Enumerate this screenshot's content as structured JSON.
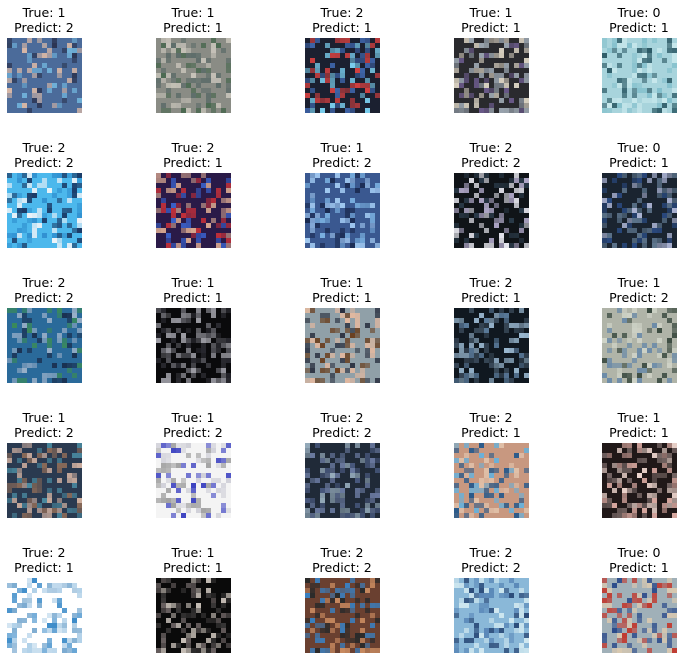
{
  "chart_data": {
    "type": "image_grid",
    "title": "",
    "rows": 5,
    "cols": 5,
    "images": [
      {
        "true_label": 1,
        "predicted_label": 2,
        "colors": [
          "#4b6b9a",
          "#2a3350",
          "#d9b8a6",
          "#6fb0d8"
        ]
      },
      {
        "true_label": 1,
        "predicted_label": 1,
        "colors": [
          "#8a8c85",
          "#4a6850",
          "#c7c3b9",
          "#5e6d6a"
        ]
      },
      {
        "true_label": 2,
        "predicted_label": 1,
        "colors": [
          "#1b2030",
          "#3e64a8",
          "#7bd0f0",
          "#d04040"
        ]
      },
      {
        "true_label": 1,
        "predicted_label": 1,
        "colors": [
          "#2a2a2e",
          "#d8d0c0",
          "#9aa4ae",
          "#6a5a8a"
        ]
      },
      {
        "true_label": 0,
        "predicted_label": 1,
        "colors": [
          "#a8d4dc",
          "#84c0cc",
          "#2c5a66",
          "#c8e8ec"
        ]
      },
      {
        "true_label": 2,
        "predicted_label": 2,
        "colors": [
          "#4cb8ec",
          "#1a3a66",
          "#f0f4f8",
          "#3090d0"
        ]
      },
      {
        "true_label": 2,
        "predicted_label": 1,
        "colors": [
          "#2a1a48",
          "#c0303a",
          "#3a60c8",
          "#d8a890"
        ]
      },
      {
        "true_label": 1,
        "predicted_label": 2,
        "colors": [
          "#3a5890",
          "#7ab0e0",
          "#1a2a50",
          "#a0c8f0"
        ]
      },
      {
        "true_label": 2,
        "predicted_label": 2,
        "colors": [
          "#101418",
          "#2a3a48",
          "#b0a8c8",
          "#e8e8f0"
        ]
      },
      {
        "true_label": 0,
        "predicted_label": 1,
        "colors": [
          "#1a2430",
          "#2a4a80",
          "#b0b8d8",
          "#607890"
        ]
      },
      {
        "true_label": 2,
        "predicted_label": 2,
        "colors": [
          "#2a6a9a",
          "#3a8a5a",
          "#9ab0c8",
          "#1a3050"
        ]
      },
      {
        "true_label": 1,
        "predicted_label": 1,
        "colors": [
          "#0a0a0c",
          "#2a2a30",
          "#a0a0a8",
          "#5a5a60"
        ]
      },
      {
        "true_label": 1,
        "predicted_label": 1,
        "colors": [
          "#90a0a8",
          "#6a4020",
          "#e0b8a0",
          "#2a3040"
        ]
      },
      {
        "true_label": 2,
        "predicted_label": 1,
        "colors": [
          "#101820",
          "#3a4a5a",
          "#9ab8d0",
          "#5a7a9a"
        ]
      },
      {
        "true_label": 1,
        "predicted_label": 2,
        "colors": [
          "#b0b4a8",
          "#3a4a40",
          "#6a8aa8",
          "#d0d4c8"
        ]
      },
      {
        "true_label": 1,
        "predicted_label": 2,
        "colors": [
          "#2a3a50",
          "#8a6a58",
          "#d0b0a0",
          "#4a8aa0"
        ]
      },
      {
        "true_label": 1,
        "predicted_label": 2,
        "colors": [
          "#f4f4f4",
          "#a0a0a0",
          "#3a40c0",
          "#d0d0d8"
        ]
      },
      {
        "true_label": 2,
        "predicted_label": 2,
        "colors": [
          "#202a38",
          "#4a5a80",
          "#9ab0c0",
          "#6a7aa0"
        ]
      },
      {
        "true_label": 2,
        "predicted_label": 1,
        "colors": [
          "#c89880",
          "#2a5a8a",
          "#6ab0d8",
          "#e0c0a8"
        ]
      },
      {
        "true_label": 1,
        "predicted_label": 1,
        "colors": [
          "#201818",
          "#d8a8a0",
          "#7a6a68",
          "#f0d8d0"
        ]
      },
      {
        "true_label": 2,
        "predicted_label": 1,
        "colors": [
          "#ffffff",
          "#3a8ac8",
          "#b0d0e8",
          "#7aaad0"
        ]
      },
      {
        "true_label": 1,
        "predicted_label": 1,
        "colors": [
          "#0a0a0a",
          "#3a3838",
          "#c8c0b8",
          "#686060"
        ]
      },
      {
        "true_label": 2,
        "predicted_label": 2,
        "colors": [
          "#6a4030",
          "#c88a60",
          "#2a2a2a",
          "#3a80c0"
        ]
      },
      {
        "true_label": 2,
        "predicted_label": 2,
        "colors": [
          "#8ab8d8",
          "#2a4a78",
          "#d0e8f0",
          "#5a88b8"
        ]
      },
      {
        "true_label": 0,
        "predicted_label": 1,
        "colors": [
          "#a0b0b8",
          "#c03a30",
          "#2a4a8a",
          "#d8c8b0"
        ]
      }
    ]
  },
  "labels": {
    "true_prefix": "True: ",
    "predict_prefix": "Predict: "
  }
}
